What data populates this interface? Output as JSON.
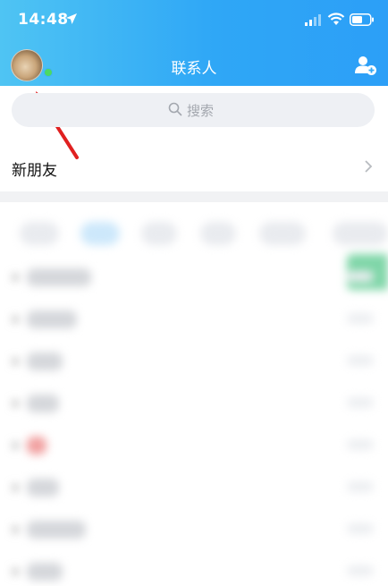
{
  "status_bar": {
    "time": "14:48",
    "icons": [
      "location-arrow-icon",
      "signal-icon",
      "wifi-icon",
      "battery-icon"
    ]
  },
  "header": {
    "title": "联系人",
    "avatar_status": "online",
    "right_icon": "add-contact-icon",
    "gradient": [
      "#4fc4f3",
      "#2c9ff7"
    ]
  },
  "search": {
    "placeholder": "搜索"
  },
  "new_friends": {
    "label": "新朋友"
  },
  "annotation": {
    "arrow_color": "#e02020"
  }
}
